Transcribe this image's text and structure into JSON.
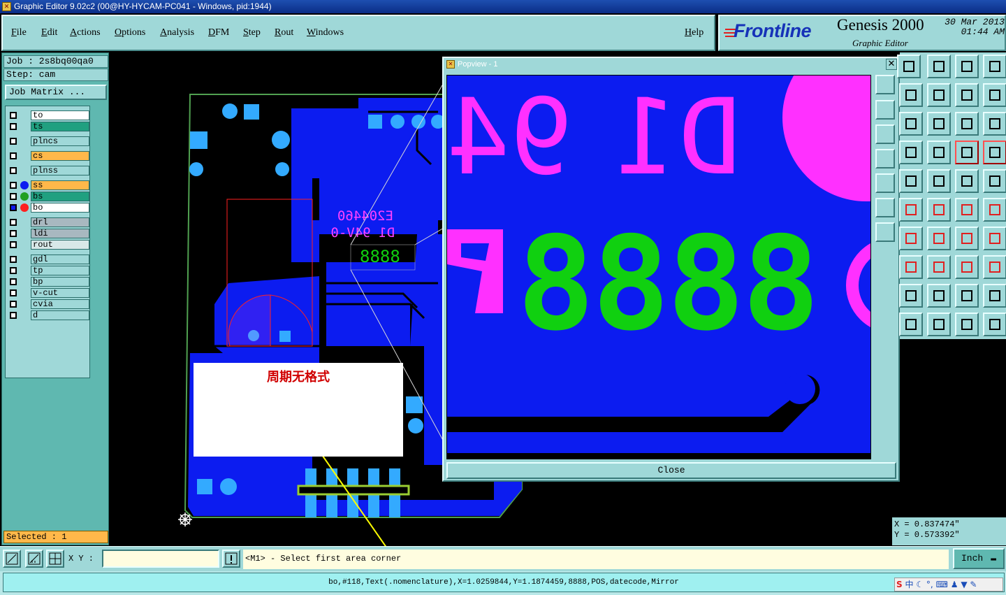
{
  "window": {
    "title": "Graphic Editor 9.02c2 (00@HY-HYCAM-PC041 - Windows, pid:1944)"
  },
  "menu": {
    "file": "File",
    "edit": "Edit",
    "actions": "Actions",
    "options": "Options",
    "analysis": "Analysis",
    "dfm": "DFM",
    "step": "Step",
    "rout": "Rout",
    "windows": "Windows",
    "help": "Help"
  },
  "brand": {
    "logo": "Frontline",
    "product": "Genesis 2000",
    "subtitle": "Graphic Editor",
    "date": "30 Mar 2013",
    "time": "01:44 AM"
  },
  "job": {
    "job": "Job : 2s8bq00qa0",
    "step": "Step: cam",
    "matrix_button": "Job Matrix ..."
  },
  "layers": [
    {
      "name": "to",
      "color": "#ffffff"
    },
    {
      "name": "ts",
      "color": "#20a080"
    },
    {
      "name": "plncs",
      "color": "#9fd8d8"
    },
    {
      "name": "cs",
      "color": "#ffb84a"
    },
    {
      "name": "plnss",
      "color": "#9fd8d8"
    },
    {
      "name": "ss",
      "color": "#ffb84a"
    },
    {
      "name": "bs",
      "color": "#20a080"
    },
    {
      "name": "bo",
      "color": "#ffffff"
    },
    {
      "name": "drl",
      "color": "#a8b8c0"
    },
    {
      "name": "ldi",
      "color": "#a8b8c0"
    },
    {
      "name": "rout",
      "color": "#d8e8e8"
    },
    {
      "name": "gdl",
      "color": "#9fd8d8"
    },
    {
      "name": "tp",
      "color": "#9fd8d8"
    },
    {
      "name": "bp",
      "color": "#9fd8d8"
    },
    {
      "name": "v-cut",
      "color": "#9fd8d8"
    },
    {
      "name": "cvia",
      "color": "#9fd8d8"
    },
    {
      "name": "d",
      "color": "#9fd8d8"
    }
  ],
  "selected": "Selected : 1",
  "popview": {
    "title": "Popview - 1",
    "close": "Close",
    "text_d1": "D1",
    "text_94": "94",
    "digits": "8888"
  },
  "board": {
    "code1": "E204460",
    "code2": "D1 94V-0",
    "digits": "8888"
  },
  "overlay_note": "周期无格式",
  "coords": {
    "x": "X = 0.837474\"",
    "y": "Y = 0.573392\""
  },
  "bottom": {
    "xy_label": "X Y :",
    "xy_value": "",
    "prompt": "<M1> - Select first area corner",
    "unit": "Inch"
  },
  "status": "bo,#118,Text(.nomenclature),X=1.0259844,Y=1.1874459,8888,POS,datecode,Mirror",
  "colors": {
    "panel": "#9fd8d8",
    "copper": "#0c1cf0",
    "silk": "#ff30ff",
    "digits": "#10d010",
    "accent": "#ffb84a"
  }
}
